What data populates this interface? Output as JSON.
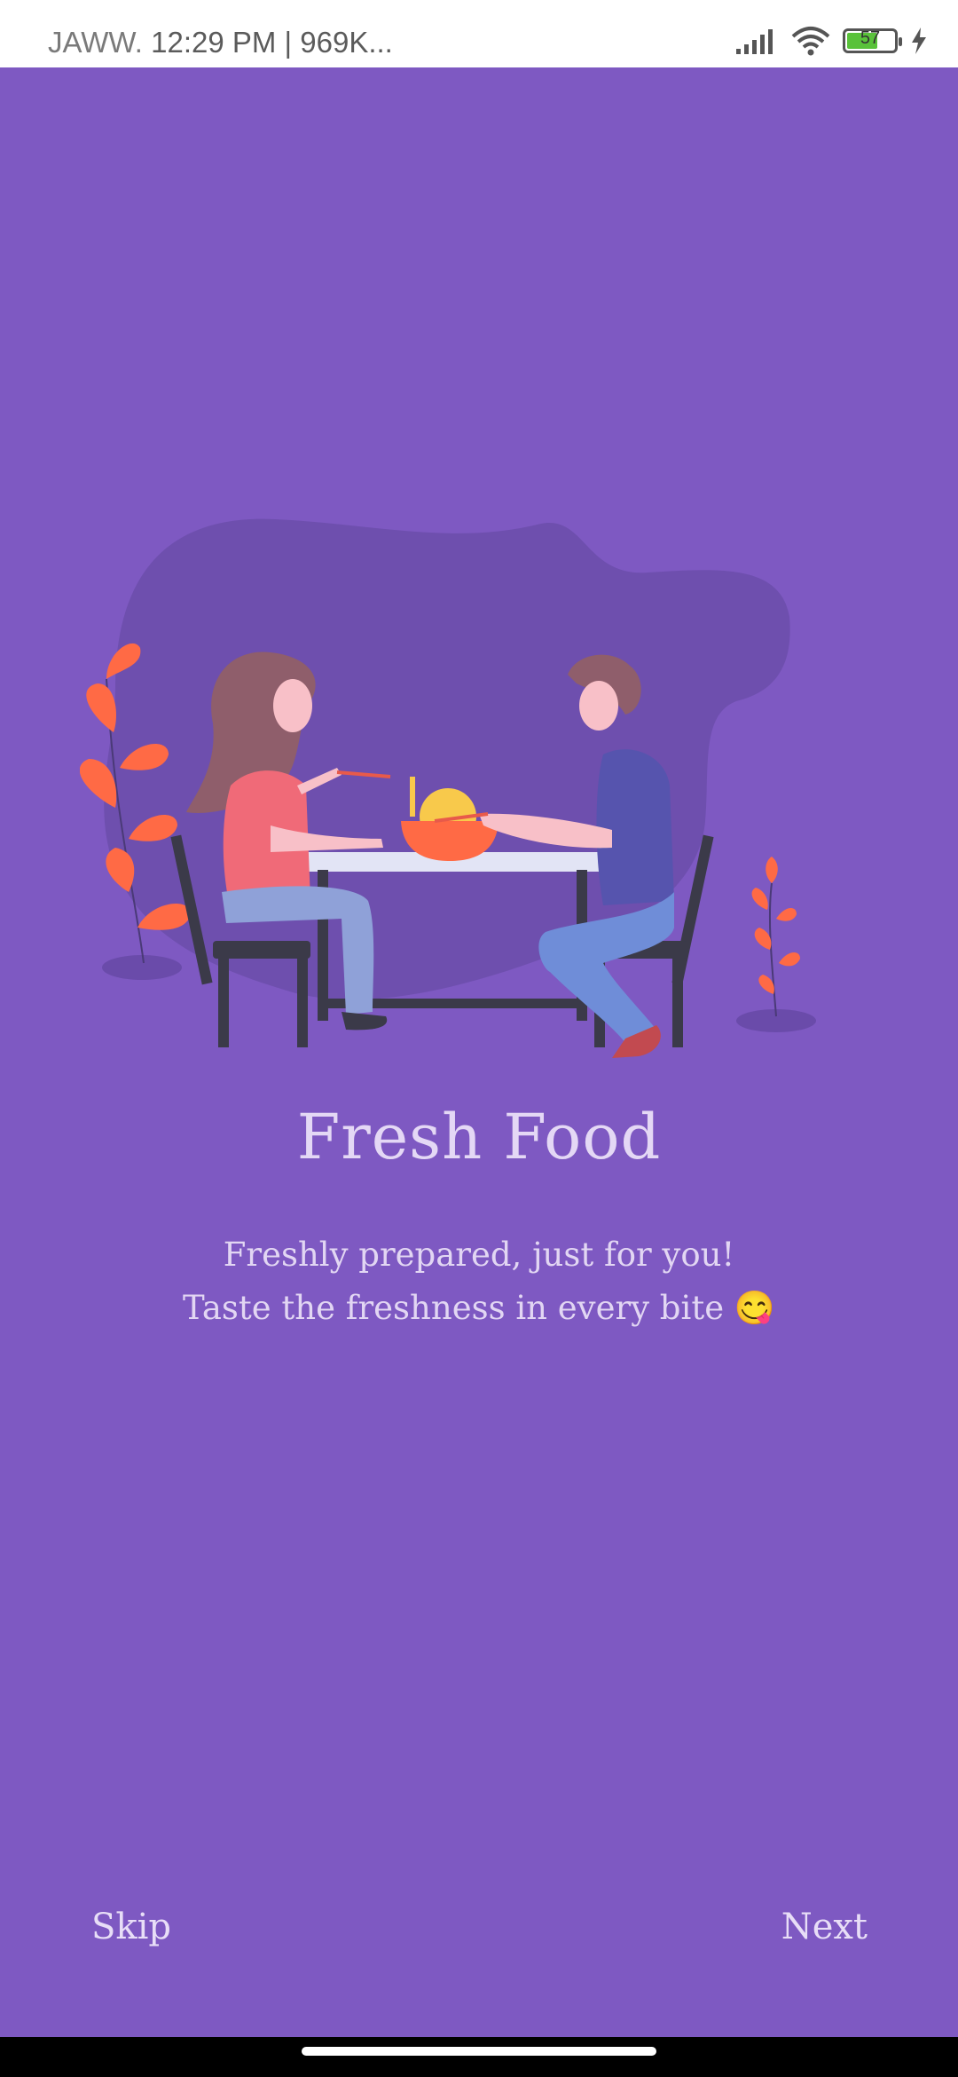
{
  "status_bar": {
    "carrier": "JAWW.",
    "time_speed": "12:29 PM | 969K...",
    "battery_level": "57",
    "icons": [
      "signal-icon",
      "wifi-icon",
      "battery-icon",
      "charging-icon"
    ]
  },
  "onboarding": {
    "title": "Fresh Food",
    "subtitle_line1": "Freshly prepared, just for you!",
    "subtitle_line2": "Taste the freshness in every bite 😋"
  },
  "actions": {
    "skip_label": "Skip",
    "next_label": "Next"
  },
  "colors": {
    "background": "#7E59C2",
    "blob": "#6E4FAE",
    "accent_leaf": "#FF6A45"
  }
}
